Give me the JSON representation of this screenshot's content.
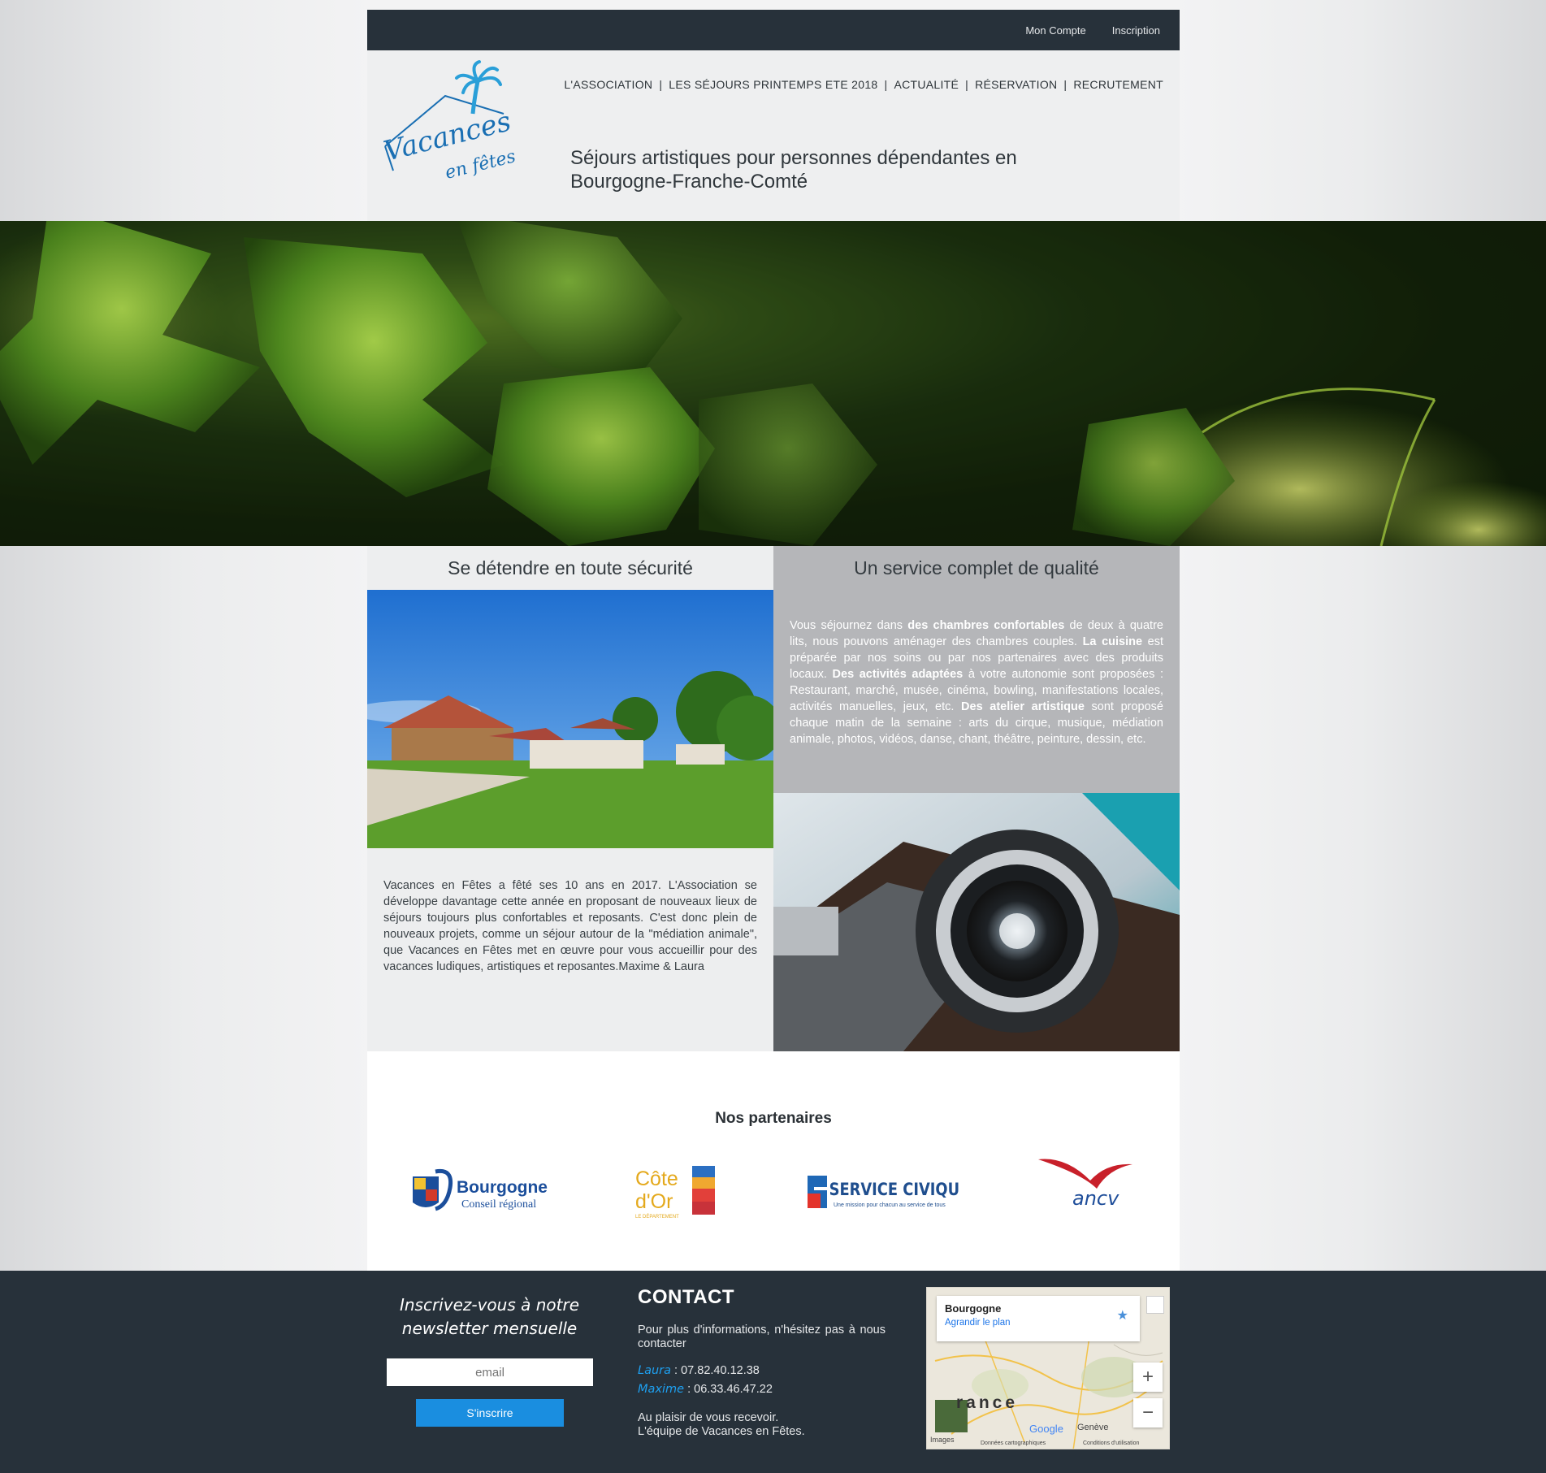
{
  "topbar": {
    "account": "Mon Compte",
    "signup": "Inscription"
  },
  "logo": {
    "line1": "Vacances",
    "line2": "en fêtes"
  },
  "nav": {
    "items": [
      "L'ASSOCIATION",
      "LES SÉJOURS PRINTEMPS ETE 2018",
      "ACTUALITÉ",
      "RÉSERVATION",
      "RECRUTEMENT"
    ],
    "separator": "|"
  },
  "tagline": "Séjours artistiques pour personnes dépendantes en Bourgogne-Franche-Comté",
  "left": {
    "title": "Se détendre en toute sécurité",
    "text": "Vacances en Fêtes a fêté ses 10 ans en 2017. L'Association se développe davantage cette année en proposant de nouveaux lieux de séjours toujours plus confortables et reposants. C'est donc plein de nouveaux projets, comme un séjour autour de la \"médiation animale\", que Vacances en Fêtes met en œuvre pour vous accueillir pour des vacances ludiques, artistiques et reposantes.Maxime & Laura"
  },
  "right": {
    "title": "Un service complet de qualité",
    "p1": "Vous séjournez dans ",
    "b1": "des chambres confortables",
    "p2": " de deux à quatre lits, nous pouvons aménager des chambres couples. ",
    "b2": "La cuisine",
    "p3": " est préparée par nos soins ou par nos partenaires avec des produits locaux. ",
    "b3": "Des activités adaptées",
    "p4": " à votre autonomie sont proposées : Restaurant, marché, musée, cinéma, bowling, manifestations locales, activités manuelles, jeux, etc. ",
    "b4": "Des atelier artistique",
    "p5": " sont proposé chaque matin de la semaine : arts du cirque, musique, médiation animale, photos, vidéos, danse, chant, théâtre, peinture, dessin, etc."
  },
  "partners": {
    "title": "Nos partenaires",
    "bourgogne": {
      "name": "Bourgogne",
      "sub": "Conseil régional"
    },
    "cotedor": {
      "l1": "Côte",
      "l2": "d'Or",
      "sub": "LE DÉPARTEMENT"
    },
    "civique": {
      "name": "SERVICE CIVIQUE",
      "sub": "Une mission pour chacun au service de tous"
    },
    "ancv": {
      "name": "ancv"
    }
  },
  "newsletter": {
    "title": "Inscrivez-vous à notre newsletter mensuelle",
    "placeholder": "email",
    "button": "S'inscrire"
  },
  "contact": {
    "title": "CONTACT",
    "intro": "Pour plus d'informations, n'hésitez pas à nous contacter",
    "laura_name": "Laura",
    "laura_phone": " : 07.82.40.12.38",
    "maxime_name": "Maxime",
    "maxime_phone": " : 06.33.46.47.22",
    "bye1": "Au plaisir de vous recevoir.",
    "bye2": "L'équipe de Vacances en Fêtes."
  },
  "map": {
    "place": "Bourgogne",
    "link": "Agrandir le plan",
    "country": "rance",
    "city": "Genève",
    "images": "Images",
    "google": "Google",
    "attribution": "Données cartographiques",
    "terms": "Conditions d'utilisation"
  },
  "colors": {
    "topbar": "#27313a",
    "accent": "#1a8ee0",
    "logo": "#1a6fb3"
  }
}
